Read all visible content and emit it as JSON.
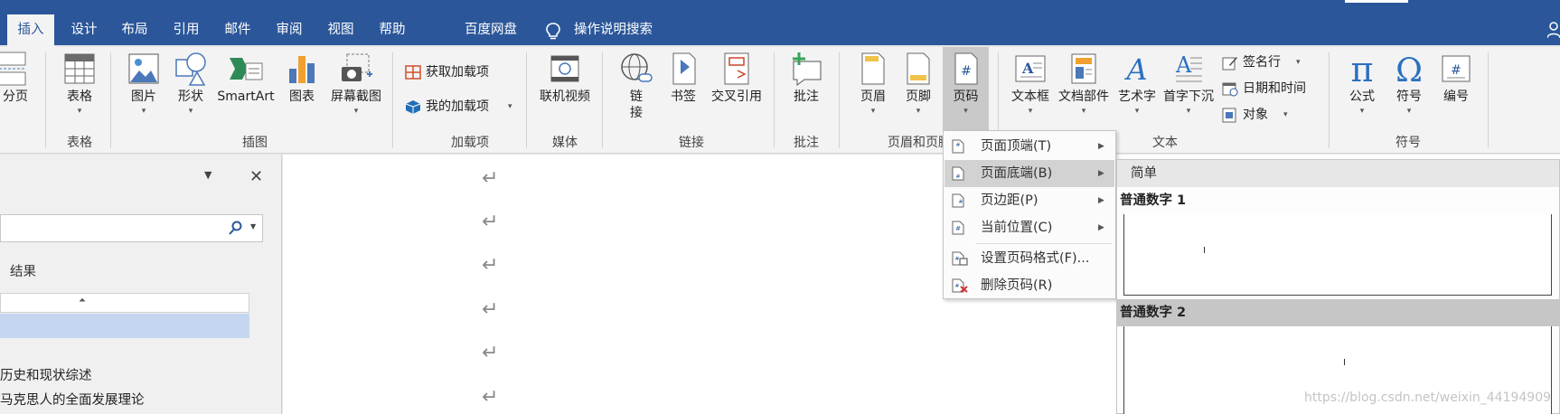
{
  "tabs": [
    "插入",
    "设计",
    "布局",
    "引用",
    "邮件",
    "审阅",
    "视图",
    "帮助",
    "百度网盘"
  ],
  "active_tab": "插入",
  "tell_me": "操作说明搜索",
  "ribbon": {
    "buttons": {
      "fenye": "分页",
      "biaoge": "表格",
      "tupian": "图片",
      "xingzhuang": "形状",
      "smartart": "SmartArt",
      "tubiao": "图表",
      "jietu": "屏幕截图",
      "lianji_shipin": "联机视频",
      "lianjie_1": "链",
      "lianjie_2": "接",
      "shuqian": "书签",
      "jiaocha": "交叉引用",
      "pizhu": "批注",
      "yemei": "页眉",
      "yejiao": "页脚",
      "yema": "页码",
      "wenbenkuang": "文本框",
      "wendang_bujian": "文档部件",
      "yishuzi": "艺术字",
      "shouzi_xiachen": "首字下沉",
      "gongshi": "公式",
      "fuhao": "符号",
      "bianhao": "编号"
    },
    "small": {
      "huoqu_jiazai": "获取加载项",
      "wode_jiazai": "我的加载项",
      "qianmingxing": "签名行",
      "riqi_shijian": "日期和时间",
      "duixiang": "对象"
    },
    "groups": {
      "biaoge": "表格",
      "chatu": "插图",
      "jiazaixiang": "加载项",
      "meiti": "媒体",
      "lianjie": "链接",
      "pizhu": "批注",
      "yemei_yejiao": "页眉和页脚",
      "wenben": "文本",
      "fuhao": "符号"
    }
  },
  "nav_pane": {
    "results_label": "结果",
    "headings": [
      "历史和现状综述",
      "马克思人的全面发展理论"
    ]
  },
  "page_number_menu": {
    "items": [
      {
        "label": "页面顶端(T)",
        "has_submenu": true
      },
      {
        "label": "页面底端(B)",
        "has_submenu": true
      },
      {
        "label": "页边距(P)",
        "has_submenu": true
      },
      {
        "label": "当前位置(C)",
        "has_submenu": true
      },
      {
        "label": "设置页码格式(F)...",
        "has_submenu": false
      },
      {
        "label": "删除页码(R)",
        "has_submenu": false
      }
    ],
    "highlighted": "页面底端(B)"
  },
  "gallery": {
    "section": "简单",
    "options": [
      "普通数字 1",
      "普通数字 2"
    ],
    "highlighted": "普通数字 2"
  },
  "watermark": "https://blog.csdn.net/weixin_44194909",
  "colors": {
    "title_bar": "#2b579a",
    "ribbon_bg": "#f3f3f3",
    "menu_highlight": "#d2d2d2",
    "nav_selection": "#c5d7f0"
  }
}
